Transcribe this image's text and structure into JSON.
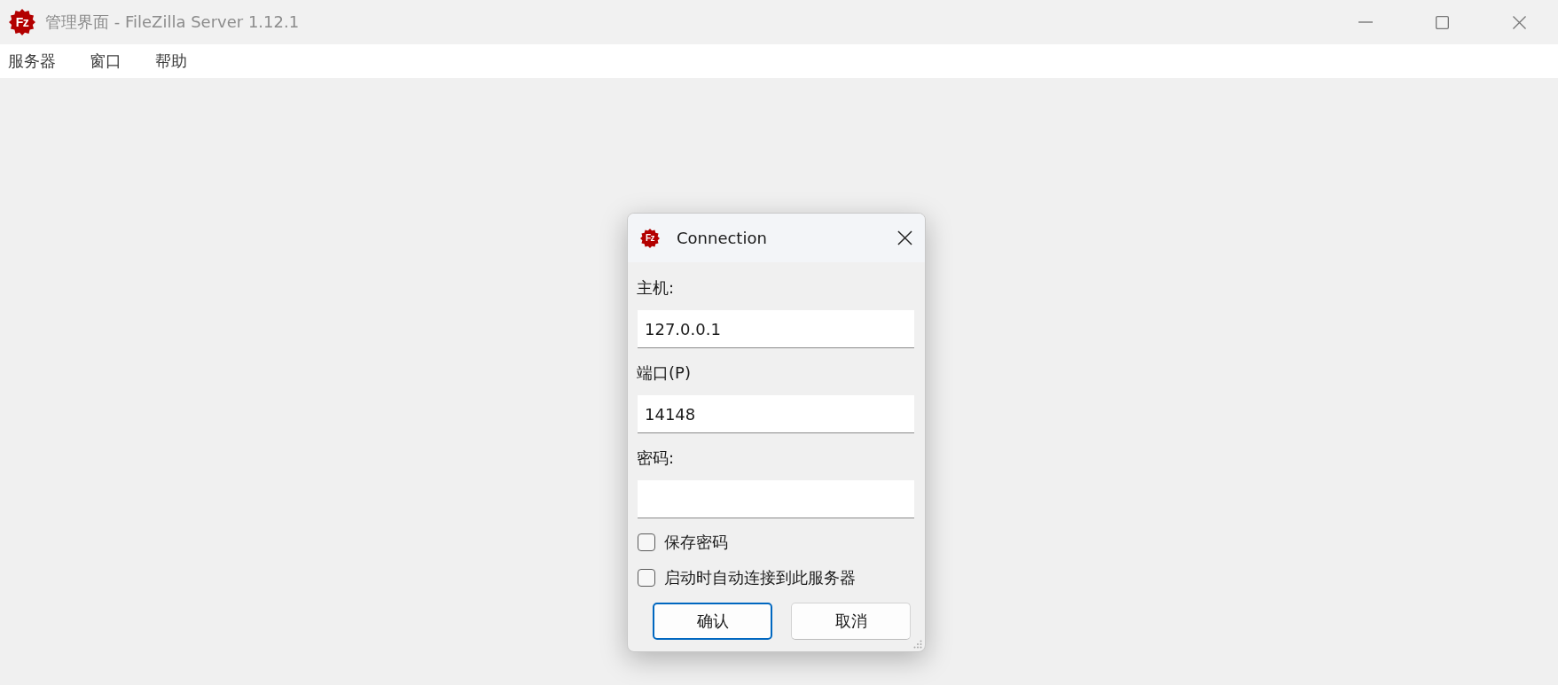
{
  "window": {
    "logo": "Fz",
    "title": "管理界面 - FileZilla Server 1.12.1"
  },
  "menu": [
    {
      "label": "服务器"
    },
    {
      "label": "窗口"
    },
    {
      "label": "帮助"
    }
  ],
  "dialog": {
    "logo": "Fz",
    "title": "Connection",
    "fields": [
      {
        "label": "主机:",
        "value": "127.0.0.1"
      },
      {
        "label": "端口(P)",
        "value": "14148"
      },
      {
        "label": "密码:"
      }
    ],
    "checkboxes": [
      {
        "label": "保存密码",
        "checked": false
      },
      {
        "label": "启动时自动连接到此服务器",
        "checked": false
      }
    ],
    "buttons": [
      {
        "label": "确认",
        "focused": true
      },
      {
        "label": "取消",
        "focused": false
      }
    ]
  }
}
